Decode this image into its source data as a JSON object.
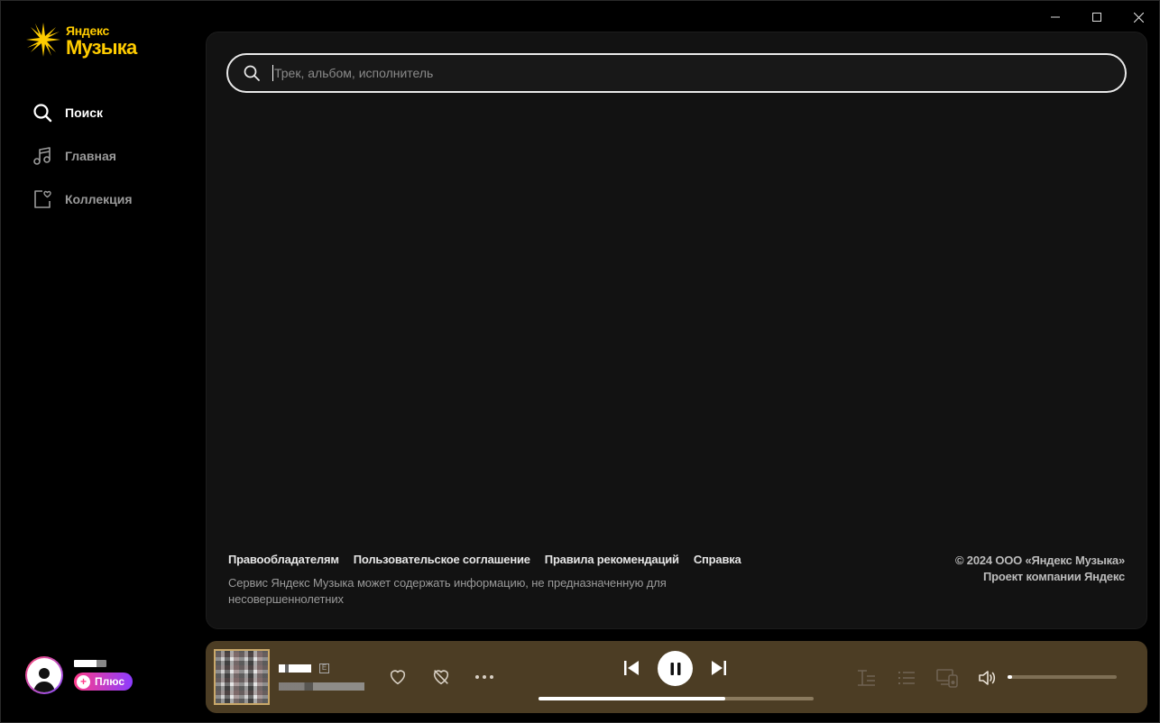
{
  "window": {
    "controls": {
      "minimize_icon": "minimize-icon",
      "maximize_icon": "maximize-icon",
      "close_icon": "close-icon"
    }
  },
  "logo": {
    "small": "Яндекс",
    "big": "Музыка",
    "color": "#ffcc00"
  },
  "sidebar": {
    "items": [
      {
        "label": "Поиск",
        "icon": "search-icon",
        "active": true
      },
      {
        "label": "Главная",
        "icon": "music-note-icon",
        "active": false
      },
      {
        "label": "Коллекция",
        "icon": "collection-heart-icon",
        "active": false
      }
    ]
  },
  "user": {
    "plus_label": "Плюс"
  },
  "search": {
    "placeholder": "Трек, альбом, исполнитель",
    "value": ""
  },
  "footer": {
    "links": [
      "Правообладателям",
      "Пользовательское соглашение",
      "Правила рекомендаций",
      "Справка"
    ],
    "note": "Сервис Яндекс Музыка может содержать информацию, не предназначенную для несовершеннолетних",
    "copyright": "© 2024  ООО «Яндекс Музыка»",
    "project": "Проект компании Яндекс"
  },
  "player": {
    "explicit_badge": "E",
    "progress": 0.68,
    "volume": 0.04,
    "state": "playing",
    "background": "#4c3d24"
  }
}
